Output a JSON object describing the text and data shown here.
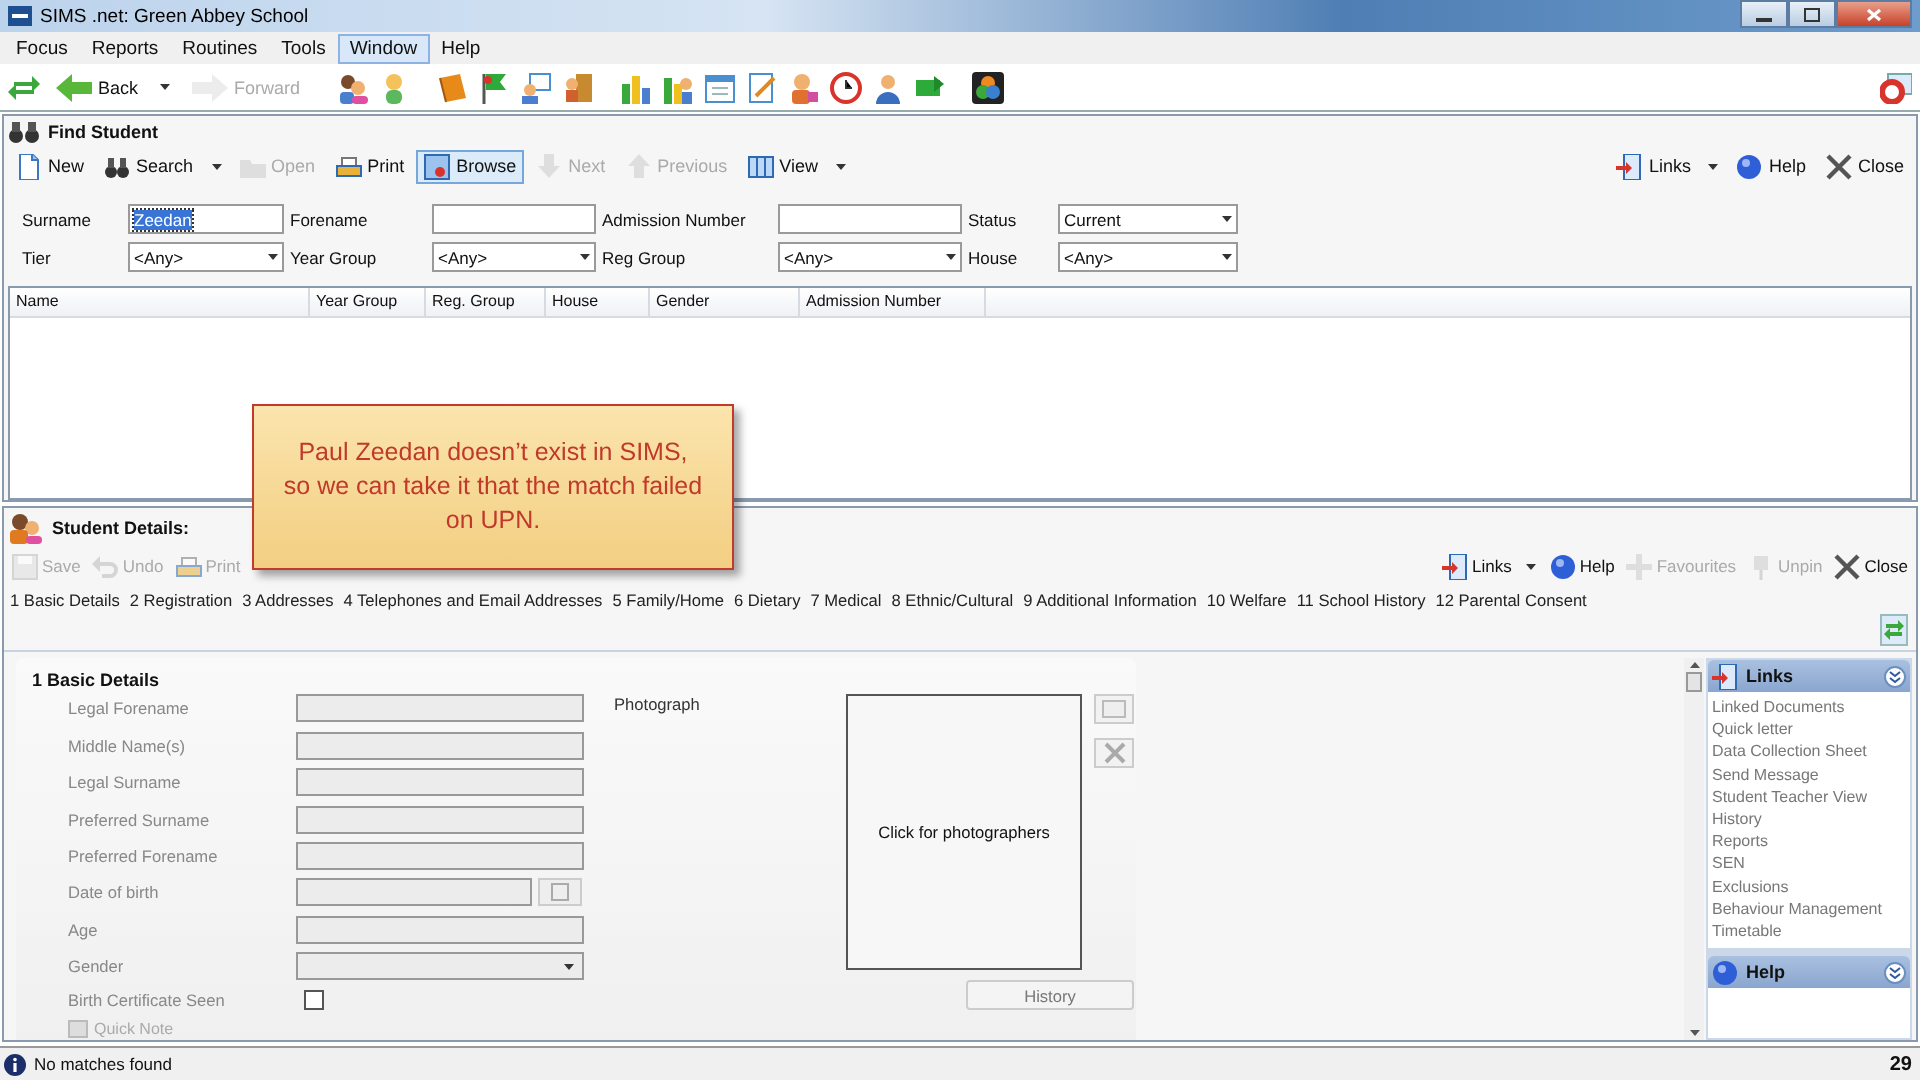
{
  "window": {
    "title": "SIMS .net: Green Abbey School"
  },
  "menu": [
    {
      "label": "Focus",
      "selected": false
    },
    {
      "label": "Reports",
      "selected": false
    },
    {
      "label": "Routines",
      "selected": false
    },
    {
      "label": "Tools",
      "selected": false
    },
    {
      "label": "Window",
      "selected": true
    },
    {
      "label": "Help",
      "selected": false
    }
  ],
  "nav": [
    {
      "label": "Back",
      "disabled": false,
      "dropdown": true
    },
    {
      "label": "Forward",
      "disabled": true,
      "dropdown": false
    }
  ],
  "find_student": {
    "title": "Find Student",
    "toolbar": [
      {
        "label": "New",
        "kind": "new",
        "disabled": false,
        "selected": false,
        "dropdown": false
      },
      {
        "label": "Search",
        "kind": "search",
        "disabled": false,
        "selected": false,
        "dropdown": true
      },
      {
        "label": "Open",
        "kind": "open",
        "disabled": true,
        "selected": false,
        "dropdown": false
      },
      {
        "label": "Print",
        "kind": "print",
        "disabled": false,
        "selected": false,
        "dropdown": false
      },
      {
        "label": "Browse",
        "kind": "browse",
        "disabled": false,
        "selected": true,
        "dropdown": false
      },
      {
        "label": "Next",
        "kind": "next",
        "disabled": true,
        "selected": false,
        "dropdown": false
      },
      {
        "label": "Previous",
        "kind": "previous",
        "disabled": true,
        "selected": false,
        "dropdown": false
      },
      {
        "label": "View",
        "kind": "view",
        "disabled": false,
        "selected": false,
        "dropdown": true
      }
    ],
    "actions": [
      {
        "label": "Links",
        "kind": "links",
        "disabled": false,
        "dropdown": true
      },
      {
        "label": "Help",
        "kind": "help",
        "disabled": false,
        "dropdown": false
      },
      {
        "label": "Close",
        "kind": "close",
        "disabled": false,
        "dropdown": false
      }
    ],
    "criteria": [
      {
        "label": "Surname",
        "kind": "text",
        "value": "Zeedan",
        "highlighted": true
      },
      {
        "label": "Forename",
        "kind": "text"
      },
      {
        "label": "Admission Number",
        "kind": "text"
      },
      {
        "label": "Status",
        "kind": "select",
        "value": "Current"
      },
      {
        "label": "Tier",
        "kind": "select",
        "value": "<Any>"
      },
      {
        "label": "Year Group",
        "kind": "select",
        "value": "<Any>"
      },
      {
        "label": "Reg Group",
        "kind": "select",
        "value": "<Any>"
      },
      {
        "label": "House",
        "kind": "select",
        "value": "<Any>"
      }
    ],
    "columns": [
      "Name",
      "Year Group",
      "Reg. Group",
      "House",
      "Gender",
      "Admission Number"
    ]
  },
  "callout": {
    "text": "Paul Zeedan doesn’t exist in SIMS, so we can take it that the match failed on UPN."
  },
  "student_details": {
    "title": "Student Details:",
    "toolbar": [
      {
        "label": "Save",
        "kind": "save",
        "disabled": true,
        "dropdown": false
      },
      {
        "label": "Undo",
        "kind": "undo",
        "disabled": true,
        "dropdown": false
      },
      {
        "label": "Print",
        "kind": "print",
        "disabled": true,
        "dropdown": false
      }
    ],
    "actions": [
      {
        "label": "Links",
        "kind": "links",
        "disabled": false,
        "dropdown": true
      },
      {
        "label": "Help",
        "kind": "help",
        "disabled": false,
        "dropdown": false
      },
      {
        "label": "Favourites",
        "kind": "favourites",
        "disabled": true,
        "dropdown": false
      },
      {
        "label": "Unpin",
        "kind": "unpin",
        "disabled": true,
        "dropdown": false
      },
      {
        "label": "Close",
        "kind": "close",
        "disabled": false,
        "dropdown": false
      }
    ],
    "tabs": [
      "1 Basic Details",
      "2 Registration",
      "3 Addresses",
      "4 Telephones and Email Addresses",
      "5 Family/Home",
      "6 Dietary",
      "7 Medical",
      "8 Ethnic/Cultural",
      "9 Additional Information",
      "10 Welfare",
      "11 School History",
      "12 Parental Consent"
    ],
    "section_title": "1 Basic Details",
    "fields": [
      {
        "label": "Legal Forename",
        "kind": "text",
        "disabled": true
      },
      {
        "label": "Middle Name(s)",
        "kind": "text",
        "disabled": true
      },
      {
        "label": "Legal Surname",
        "kind": "text",
        "disabled": true
      },
      {
        "label": "Preferred Surname",
        "kind": "text",
        "disabled": true
      },
      {
        "label": "Preferred Forename",
        "kind": "text",
        "disabled": true
      },
      {
        "label": "Date of birth",
        "kind": "date",
        "disabled": true
      },
      {
        "label": "Age",
        "kind": "text",
        "disabled": true
      },
      {
        "label": "Gender",
        "kind": "select",
        "disabled": true
      },
      {
        "label": "Birth Certificate Seen",
        "kind": "checkbox",
        "checked": false,
        "disabled": true
      }
    ],
    "photo_label": "Photograph",
    "photo_prompt": "Click for photographers",
    "history_button": "History",
    "quick_note": "Quick Note"
  },
  "links_panel": {
    "title": "Links",
    "items": [
      "Linked Documents",
      "Quick letter",
      "Data Collection Sheet",
      "Send Message",
      "Student Teacher View",
      "History",
      "Reports",
      "SEN",
      "Exclusions",
      "Behaviour Management",
      "Timetable"
    ]
  },
  "help_panel": {
    "title": "Help"
  },
  "status_bar": {
    "message": "No matches found",
    "page": "29"
  }
}
